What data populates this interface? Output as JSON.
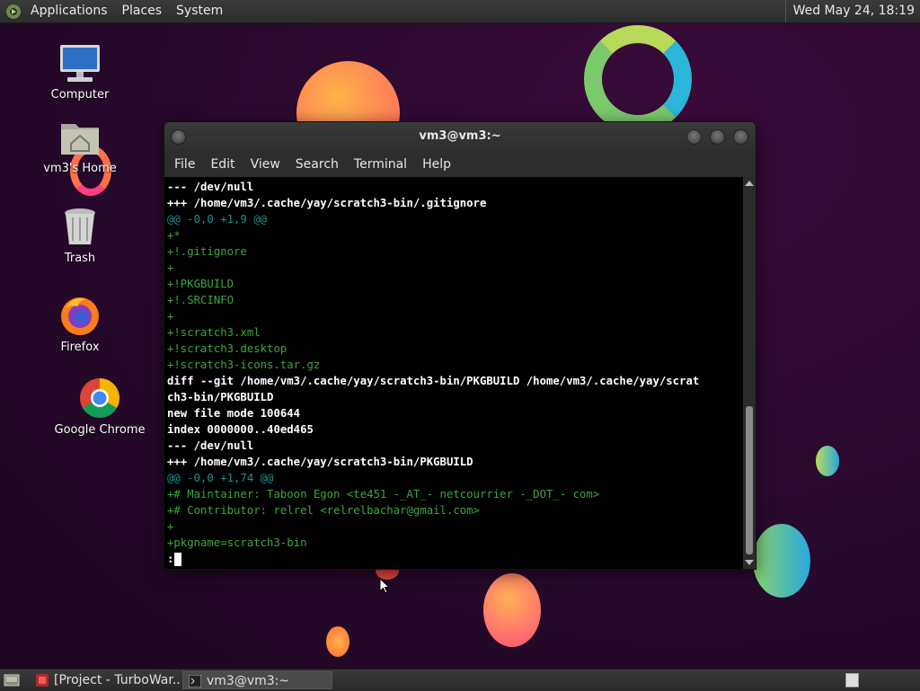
{
  "top_panel": {
    "menu": [
      "Applications",
      "Places",
      "System"
    ],
    "clock": "Wed May 24, 18:19"
  },
  "desktop_icons": [
    {
      "label": "Computer",
      "icon": "computer-icon"
    },
    {
      "label": "vm3's Home",
      "icon": "home-folder-icon"
    },
    {
      "label": "Trash",
      "icon": "trash-icon"
    },
    {
      "label": "Firefox",
      "icon": "firefox-icon"
    },
    {
      "label": "Google Chrome",
      "icon": "chrome-icon"
    }
  ],
  "terminal": {
    "title": "vm3@vm3:~",
    "menu": [
      "File",
      "Edit",
      "View",
      "Search",
      "Terminal",
      "Help"
    ],
    "lines": [
      {
        "text": "--- /dev/null",
        "style": "bold"
      },
      {
        "text": "+++ /home/vm3/.cache/yay/scratch3-bin/.gitignore",
        "style": "bold"
      },
      {
        "text": "@@ -0,0 +1,9 @@",
        "style": "cyan"
      },
      {
        "text": "+*",
        "style": "green"
      },
      {
        "text": "+!.gitignore",
        "style": "green"
      },
      {
        "text": "+",
        "style": "green"
      },
      {
        "text": "+!PKGBUILD",
        "style": "green"
      },
      {
        "text": "+!.SRCINFO",
        "style": "green"
      },
      {
        "text": "+",
        "style": "green"
      },
      {
        "text": "+!scratch3.xml",
        "style": "green"
      },
      {
        "text": "+!scratch3.desktop",
        "style": "green"
      },
      {
        "text": "+!scratch3-icons.tar.gz",
        "style": "green"
      },
      {
        "text": "diff --git /home/vm3/.cache/yay/scratch3-bin/PKGBUILD /home/vm3/.cache/yay/scrat",
        "style": "bold"
      },
      {
        "text": "ch3-bin/PKGBUILD",
        "style": "bold"
      },
      {
        "text": "new file mode 100644",
        "style": "bold"
      },
      {
        "text": "index 0000000..40ed465",
        "style": "bold"
      },
      {
        "text": "--- /dev/null",
        "style": "bold"
      },
      {
        "text": "+++ /home/vm3/.cache/yay/scratch3-bin/PKGBUILD",
        "style": "bold"
      },
      {
        "text": "@@ -0,0 +1,74 @@",
        "style": "cyan"
      },
      {
        "text": "+# Maintainer: Taboon Egon <te451 -_AT_- netcourrier -_DOT_- com>",
        "style": "green"
      },
      {
        "text": "+# Contributor: relrel <relrelbachar@gmail.com>",
        "style": "green"
      },
      {
        "text": "+",
        "style": "green"
      },
      {
        "text": "+pkgname=scratch3-bin",
        "style": "green"
      }
    ],
    "prompt": ":"
  },
  "taskbar": {
    "items": [
      {
        "label": "[Project - TurboWar...",
        "icon": "turbowarp-icon"
      },
      {
        "label": "vm3@vm3:~",
        "icon": "terminal-icon"
      }
    ]
  }
}
